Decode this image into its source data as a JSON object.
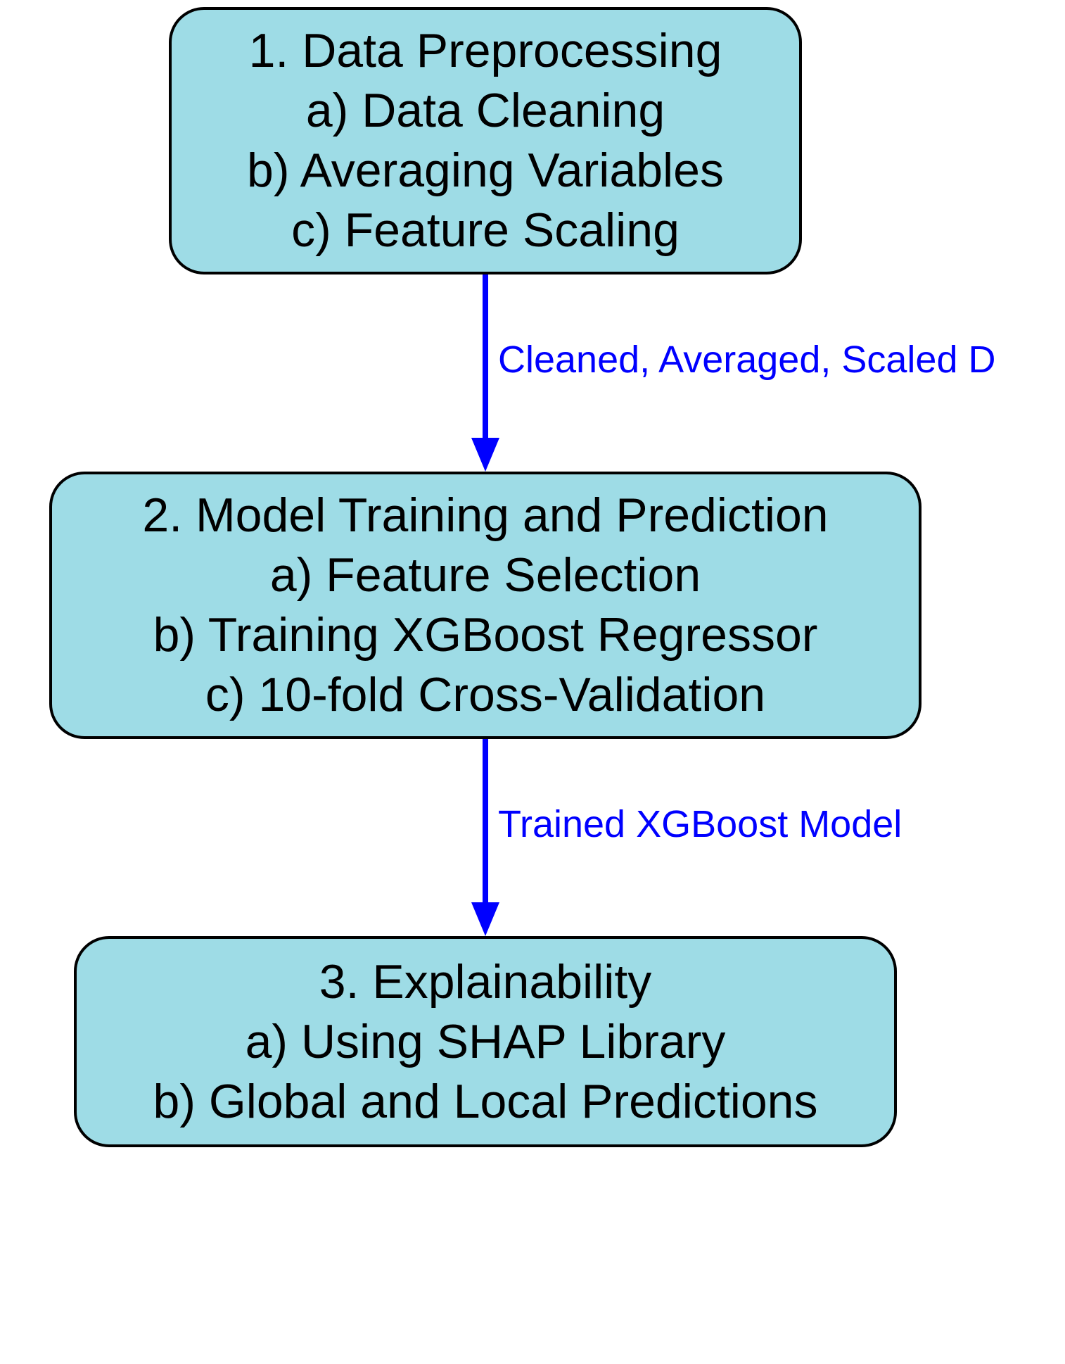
{
  "diagram": {
    "nodes": {
      "preprocessing": {
        "title": "1. Data Preprocessing",
        "item_a": "a) Data Cleaning",
        "item_b": "b) Averaging Variables",
        "item_c": "c) Feature Scaling"
      },
      "training": {
        "title": "2. Model Training and Prediction",
        "item_a": "a) Feature Selection",
        "item_b": "b) Training XGBoost Regressor",
        "item_c": "c) 10-fold Cross-Validation"
      },
      "explainability": {
        "title": "3. Explainability",
        "item_a": "a) Using SHAP Library",
        "item_b": "b) Global and Local Predictions"
      }
    },
    "edges": {
      "edge1_label": "Cleaned, Averaged, Scaled D",
      "edge2_label": "Trained XGBoost Model"
    },
    "style": {
      "node_fill": "#9edce6",
      "node_stroke": "#000000",
      "arrow_color": "#0000ff",
      "label_color": "#0000ff"
    }
  }
}
